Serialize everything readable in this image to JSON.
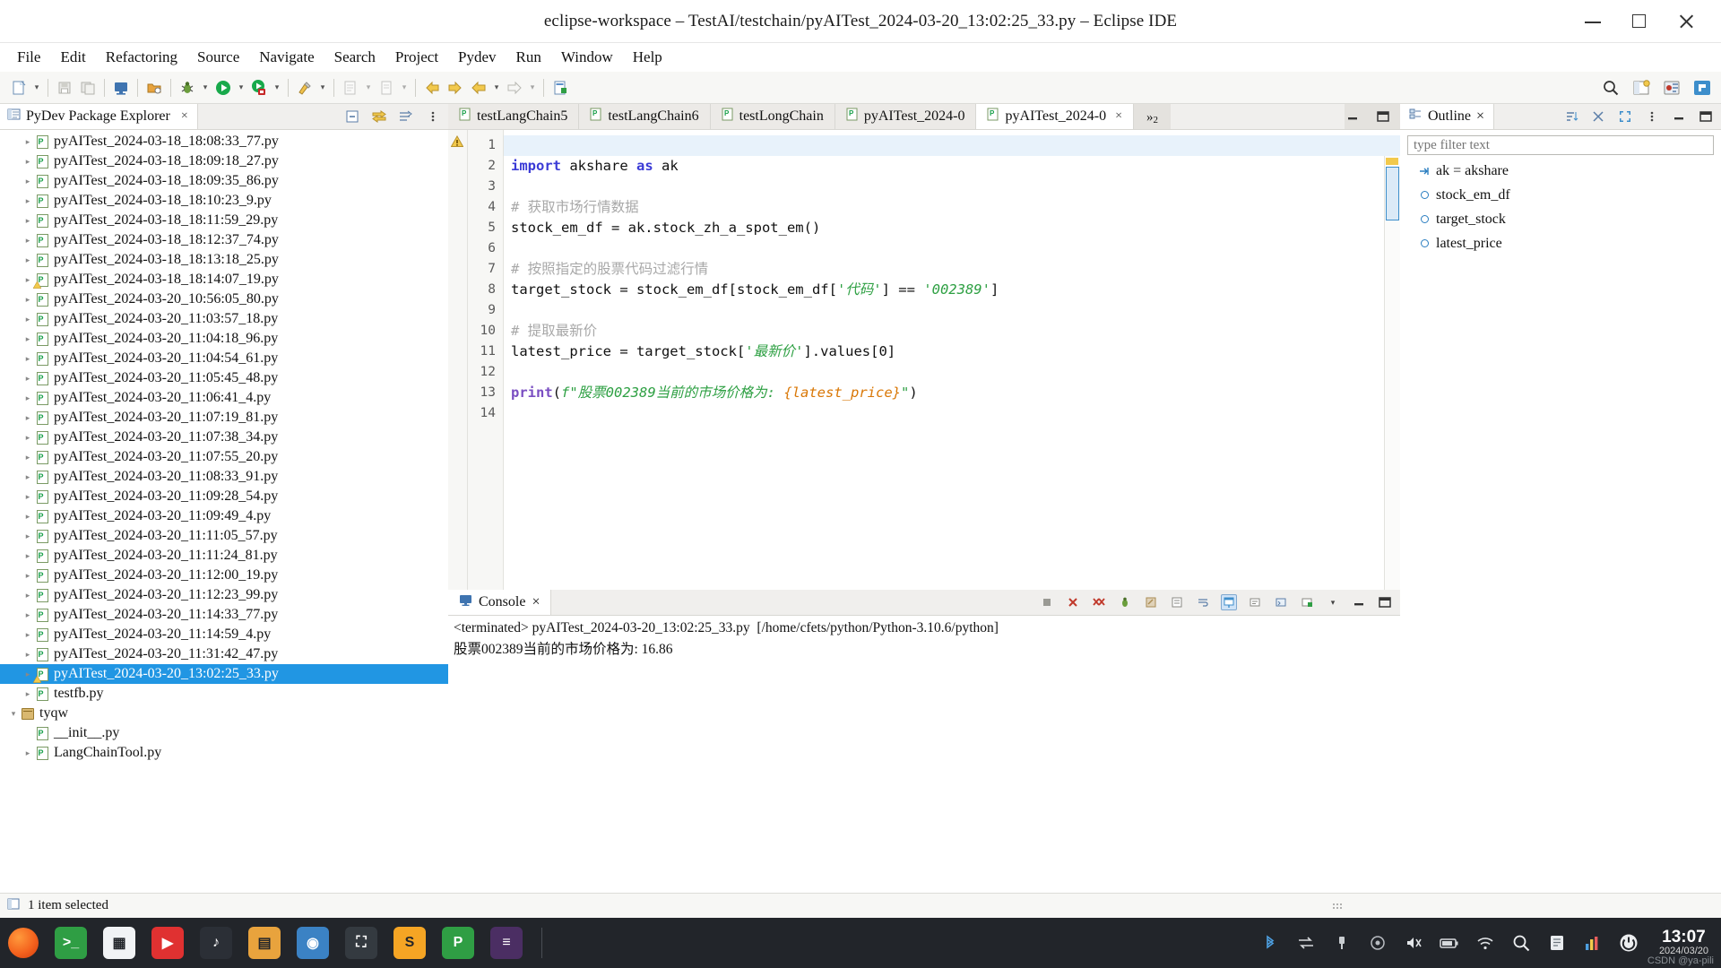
{
  "window": {
    "title": "eclipse-workspace  –  TestAI/testchain/pyAITest_2024-03-20_13:02:25_33.py  –  Eclipse IDE",
    "minimize_label": "Minimize",
    "maximize_label": "Maximize",
    "close_label": "Close"
  },
  "menubar": {
    "items": [
      "File",
      "Edit",
      "Refactoring",
      "Source",
      "Navigate",
      "Search",
      "Project",
      "Pydev",
      "Run",
      "Window",
      "Help"
    ]
  },
  "toolbar": {
    "icons": [
      "new-file-icon",
      "new-file-dropdown-icon",
      "save-icon",
      "save-all-icon",
      "console-icon",
      "open-type-icon",
      "debug-icon",
      "debug-dropdown-icon",
      "run-icon",
      "run-dropdown-icon",
      "coverage-icon",
      "coverage-dropdown-icon",
      "external-tools-icon",
      "external-tools-dropdown-icon",
      "new-pydev-project-icon",
      "new-pydev-project-dropdown-icon",
      "new-pydev-module-icon",
      "new-pydev-module-dropdown-icon",
      "back-icon",
      "forward-icon",
      "previous-edit-icon",
      "previous-edit-dropdown-icon",
      "next-edit-icon",
      "next-edit-dropdown-icon",
      "new-window-icon"
    ],
    "right_icons": [
      "search-icon",
      "open-perspective-icon",
      "java-perspective-icon",
      "pydev-perspective-icon"
    ]
  },
  "explorer": {
    "tab_label": "PyDev Package Explorer",
    "tab_close": "×",
    "tools": [
      "collapse-all-icon",
      "link-with-editor-icon",
      "focus-on-active-task-icon",
      "view-menu-icon"
    ],
    "min_max": [
      "minimize-icon",
      "maximize-icon"
    ],
    "items": [
      {
        "label": "pyAITest_2024-03-18_18:08:33_77.py",
        "icon": "python-file-icon",
        "indent": 2,
        "selected": false,
        "warn": false
      },
      {
        "label": "pyAITest_2024-03-18_18:09:18_27.py",
        "icon": "python-file-icon",
        "indent": 2,
        "selected": false,
        "warn": false
      },
      {
        "label": "pyAITest_2024-03-18_18:09:35_86.py",
        "icon": "python-file-icon",
        "indent": 2,
        "selected": false,
        "warn": false
      },
      {
        "label": "pyAITest_2024-03-18_18:10:23_9.py",
        "icon": "python-file-icon",
        "indent": 2,
        "selected": false,
        "warn": false
      },
      {
        "label": "pyAITest_2024-03-18_18:11:59_29.py",
        "icon": "python-file-icon",
        "indent": 2,
        "selected": false,
        "warn": false
      },
      {
        "label": "pyAITest_2024-03-18_18:12:37_74.py",
        "icon": "python-file-icon",
        "indent": 2,
        "selected": false,
        "warn": false
      },
      {
        "label": "pyAITest_2024-03-18_18:13:18_25.py",
        "icon": "python-file-icon",
        "indent": 2,
        "selected": false,
        "warn": false
      },
      {
        "label": "pyAITest_2024-03-18_18:14:07_19.py",
        "icon": "python-file-warning-icon",
        "indent": 2,
        "selected": false,
        "warn": true
      },
      {
        "label": "pyAITest_2024-03-20_10:56:05_80.py",
        "icon": "python-file-icon",
        "indent": 2,
        "selected": false,
        "warn": false
      },
      {
        "label": "pyAITest_2024-03-20_11:03:57_18.py",
        "icon": "python-file-icon",
        "indent": 2,
        "selected": false,
        "warn": false
      },
      {
        "label": "pyAITest_2024-03-20_11:04:18_96.py",
        "icon": "python-file-icon",
        "indent": 2,
        "selected": false,
        "warn": false
      },
      {
        "label": "pyAITest_2024-03-20_11:04:54_61.py",
        "icon": "python-file-icon",
        "indent": 2,
        "selected": false,
        "warn": false
      },
      {
        "label": "pyAITest_2024-03-20_11:05:45_48.py",
        "icon": "python-file-icon",
        "indent": 2,
        "selected": false,
        "warn": false
      },
      {
        "label": "pyAITest_2024-03-20_11:06:41_4.py",
        "icon": "python-file-icon",
        "indent": 2,
        "selected": false,
        "warn": false
      },
      {
        "label": "pyAITest_2024-03-20_11:07:19_81.py",
        "icon": "python-file-icon",
        "indent": 2,
        "selected": false,
        "warn": false
      },
      {
        "label": "pyAITest_2024-03-20_11:07:38_34.py",
        "icon": "python-file-icon",
        "indent": 2,
        "selected": false,
        "warn": false
      },
      {
        "label": "pyAITest_2024-03-20_11:07:55_20.py",
        "icon": "python-file-icon",
        "indent": 2,
        "selected": false,
        "warn": false
      },
      {
        "label": "pyAITest_2024-03-20_11:08:33_91.py",
        "icon": "python-file-icon",
        "indent": 2,
        "selected": false,
        "warn": false
      },
      {
        "label": "pyAITest_2024-03-20_11:09:28_54.py",
        "icon": "python-file-icon",
        "indent": 2,
        "selected": false,
        "warn": false
      },
      {
        "label": "pyAITest_2024-03-20_11:09:49_4.py",
        "icon": "python-file-icon",
        "indent": 2,
        "selected": false,
        "warn": false
      },
      {
        "label": "pyAITest_2024-03-20_11:11:05_57.py",
        "icon": "python-file-icon",
        "indent": 2,
        "selected": false,
        "warn": false
      },
      {
        "label": "pyAITest_2024-03-20_11:11:24_81.py",
        "icon": "python-file-icon",
        "indent": 2,
        "selected": false,
        "warn": false
      },
      {
        "label": "pyAITest_2024-03-20_11:12:00_19.py",
        "icon": "python-file-icon",
        "indent": 2,
        "selected": false,
        "warn": false
      },
      {
        "label": "pyAITest_2024-03-20_11:12:23_99.py",
        "icon": "python-file-icon",
        "indent": 2,
        "selected": false,
        "warn": false
      },
      {
        "label": "pyAITest_2024-03-20_11:14:33_77.py",
        "icon": "python-file-icon",
        "indent": 2,
        "selected": false,
        "warn": false
      },
      {
        "label": "pyAITest_2024-03-20_11:14:59_4.py",
        "icon": "python-file-icon",
        "indent": 2,
        "selected": false,
        "warn": false
      },
      {
        "label": "pyAITest_2024-03-20_11:31:42_47.py",
        "icon": "python-file-icon",
        "indent": 2,
        "selected": false,
        "warn": false
      },
      {
        "label": "pyAITest_2024-03-20_13:02:25_33.py",
        "icon": "python-file-warning-icon",
        "indent": 2,
        "selected": true,
        "warn": true
      },
      {
        "label": "testfb.py",
        "icon": "python-file-icon",
        "indent": 2,
        "selected": false,
        "warn": false
      },
      {
        "label": "tyqw",
        "icon": "package-icon",
        "indent": 1,
        "selected": false,
        "warn": false,
        "expanded": true
      },
      {
        "label": "__init__.py",
        "icon": "python-file-icon",
        "indent": 2,
        "selected": false,
        "warn": false,
        "noarrow": true
      },
      {
        "label": "LangChainTool.py",
        "icon": "python-file-icon",
        "indent": 2,
        "selected": false,
        "warn": false
      }
    ]
  },
  "editor": {
    "tabs": [
      {
        "label": "testLangChain5",
        "active": false,
        "closable": false
      },
      {
        "label": "testLangChain6",
        "active": false,
        "closable": false
      },
      {
        "label": "testLongChain",
        "active": false,
        "closable": false
      },
      {
        "label": "pyAITest_2024-0",
        "active": false,
        "closable": false
      },
      {
        "label": "pyAITest_2024-0",
        "active": true,
        "closable": true
      }
    ],
    "overflow_label": "»",
    "overflow_count": "2",
    "min_max": [
      "minimize-icon",
      "maximize-icon"
    ],
    "line_numbers": [
      "1",
      "2",
      "3",
      "4",
      "5",
      "6",
      "7",
      "8",
      "9",
      "10",
      "11",
      "12",
      "13",
      "14"
    ],
    "current_line": 1,
    "lines": [
      {
        "n": 1,
        "tokens": []
      },
      {
        "n": 2,
        "tokens": [
          {
            "t": "import ",
            "c": "kw"
          },
          {
            "t": "akshare ",
            "c": ""
          },
          {
            "t": "as ",
            "c": "kw"
          },
          {
            "t": "ak",
            "c": ""
          }
        ]
      },
      {
        "n": 3,
        "tokens": []
      },
      {
        "n": 4,
        "tokens": [
          {
            "t": "# 获取市场行情数据",
            "c": "cmt"
          }
        ]
      },
      {
        "n": 5,
        "tokens": [
          {
            "t": "stock_em_df = ak.stock_zh_a_spot_em()",
            "c": ""
          }
        ]
      },
      {
        "n": 6,
        "tokens": []
      },
      {
        "n": 7,
        "tokens": [
          {
            "t": "# 按照指定的股票代码过滤行情",
            "c": "cmt"
          }
        ]
      },
      {
        "n": 8,
        "tokens": [
          {
            "t": "target_stock = stock_em_df[stock_em_df[",
            "c": ""
          },
          {
            "t": "'代码'",
            "c": "str"
          },
          {
            "t": "] == ",
            "c": ""
          },
          {
            "t": "'002389'",
            "c": "num"
          },
          {
            "t": "]",
            "c": ""
          }
        ]
      },
      {
        "n": 9,
        "tokens": []
      },
      {
        "n": 10,
        "tokens": [
          {
            "t": "# 提取最新价",
            "c": "cmt"
          }
        ]
      },
      {
        "n": 11,
        "tokens": [
          {
            "t": "latest_price = target_stock[",
            "c": ""
          },
          {
            "t": "'最新价'",
            "c": "str"
          },
          {
            "t": "].values[0]",
            "c": ""
          }
        ]
      },
      {
        "n": 12,
        "tokens": []
      },
      {
        "n": 13,
        "tokens": [
          {
            "t": "print",
            "c": "fn"
          },
          {
            "t": "(",
            "c": ""
          },
          {
            "t": "f\"股票002389当前的市场价格为: ",
            "c": "str"
          },
          {
            "t": "{latest_price}",
            "c": "brace"
          },
          {
            "t": "\"",
            "c": "str"
          },
          {
            "t": ")",
            "c": ""
          }
        ]
      },
      {
        "n": 14,
        "tokens": []
      }
    ]
  },
  "console": {
    "tab_label": "Console",
    "tab_close": "×",
    "tools": [
      "terminate-icon",
      "remove-launch-icon",
      "remove-all-terminated-icon",
      "debug-console-icon",
      "clear-console-icon",
      "scroll-lock-icon",
      "word-wrap-icon",
      "pin-console-icon",
      "display-selected-console-icon",
      "open-console-icon",
      "open-console-dropdown-icon",
      "new-console-view-icon",
      "new-console-view-dropdown-icon"
    ],
    "min_max": [
      "minimize-icon",
      "maximize-icon"
    ],
    "header": "<terminated> pyAITest_2024-03-20_13:02:25_33.py  [/home/cfets/python/Python-3.10.6/python]",
    "output": "股票002389当前的市场价格为: 16.86"
  },
  "outline": {
    "tab_label": "Outline",
    "tab_close": "×",
    "tools": [
      "sort-icon",
      "hide-fields-icon",
      "expand-all-icon",
      "view-menu-icon"
    ],
    "min_max": [
      "minimize-icon",
      "maximize-icon"
    ],
    "filter_placeholder": "type filter text",
    "filter_value": "",
    "items": [
      {
        "label": "ak = akshare",
        "icon": "import-icon"
      },
      {
        "label": "stock_em_df",
        "icon": "variable-icon"
      },
      {
        "label": "target_stock",
        "icon": "variable-icon"
      },
      {
        "label": "latest_price",
        "icon": "variable-icon"
      }
    ]
  },
  "statusbar": {
    "icon": "selection-icon",
    "text": "1 item selected"
  },
  "taskbar": {
    "start_label": "start-button",
    "apps": [
      {
        "name": "terminal-app-icon",
        "glyph": ">_",
        "bg": "#2f9e44"
      },
      {
        "name": "files-app-icon",
        "glyph": "▦",
        "bg": "#f1f3f5"
      },
      {
        "name": "media-app-icon",
        "glyph": "▶",
        "bg": "#e03131"
      },
      {
        "name": "music-app-icon",
        "glyph": "♪",
        "bg": "#2b2f36"
      },
      {
        "name": "store-app-icon",
        "glyph": "▤",
        "bg": "#e8a33d"
      },
      {
        "name": "browser-app-icon",
        "glyph": "◉",
        "bg": "#3b82c4"
      },
      {
        "name": "screenshot-app-icon",
        "glyph": "⛶",
        "bg": "#343a40"
      },
      {
        "name": "sublime-app-icon",
        "glyph": "S",
        "bg": "#f5a524"
      },
      {
        "name": "pycharm-app-icon",
        "glyph": "P",
        "bg": "#2f9e44"
      },
      {
        "name": "eclipse-app-icon",
        "glyph": "≡",
        "bg": "#4b2e63"
      }
    ],
    "tray": [
      "bluetooth-icon",
      "network-transfer-icon",
      "usb-icon",
      "accessibility-icon",
      "volume-icon",
      "battery-icon",
      "wifi-icon",
      "search-icon",
      "notes-icon",
      "chart-icon",
      "power-icon"
    ],
    "clock_time": "13:07",
    "clock_date": "2024/03/20",
    "watermark": "CSDN @ya-pili"
  },
  "colors": {
    "selection_blue": "#2196e3",
    "accent_yellow": "#f2c94c",
    "keyword_blue": "#3b3bd6",
    "string_green": "#2ea043",
    "comment_gray": "#a8a8a8",
    "taskbar_bg": "#22252a"
  }
}
